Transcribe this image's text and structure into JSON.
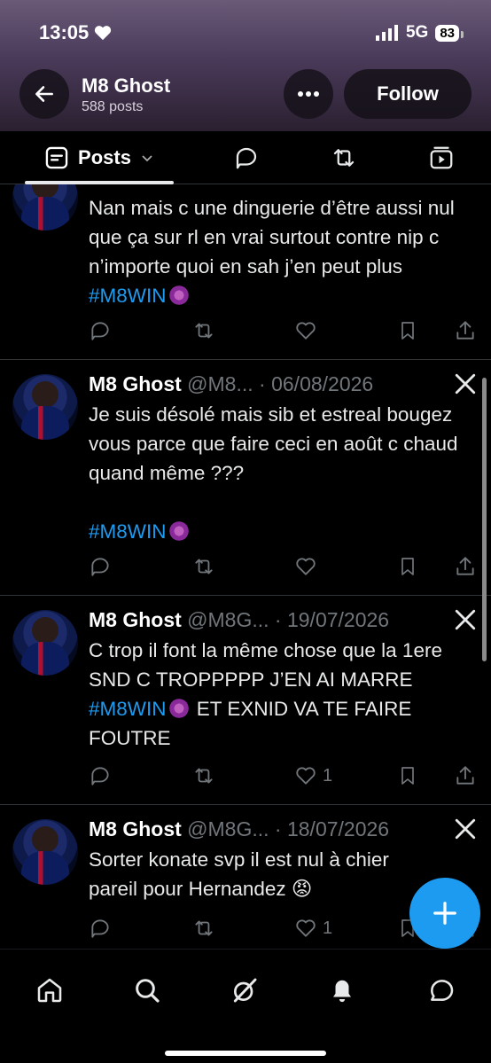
{
  "status_bar": {
    "time": "13:05",
    "network": "5G",
    "battery": "83"
  },
  "header": {
    "name": "M8 Ghost",
    "post_count": "588 posts",
    "follow_label": "Follow"
  },
  "tabs": {
    "posts_label": "Posts"
  },
  "posts": [
    {
      "name": "",
      "handle": "",
      "date": "",
      "text_plain": "Nan mais c une dinguerie d’être aussi nul que ça sur rl en vrai surtout contre nip c n’importe quoi en sah j’en peut plus ",
      "hashtag": "#M8WIN",
      "like_count": ""
    },
    {
      "name": "M8 Ghost",
      "handle": "@M8...",
      "date": "· 06/08/2026",
      "text_plain": "Je suis désolé mais sib et estreal bougez vous parce que faire ceci en août c chaud quand même ???",
      "hashtag": "#M8WIN",
      "like_count": ""
    },
    {
      "name": "M8 Ghost",
      "handle": "@M8G...",
      "date": "· 19/07/2026",
      "text_before": "C trop il font la même chose que la 1ere SND C TROPPPPP J’EN AI MARRE ",
      "hashtag": "#M8WIN",
      "text_after": " ET EXNID VA TE FAIRE FOUTRE",
      "like_count": "1"
    },
    {
      "name": "M8 Ghost",
      "handle": "@M8G...",
      "date": "· 18/07/2026",
      "text_plain": "Sorter konate svp il est nul à chier pareil pour Hernandez 😡",
      "like_count": "1"
    }
  ],
  "colors": {
    "accent": "#1d9bf0",
    "text_secondary": "#71767b",
    "divider": "#2f3336"
  },
  "icons": [
    "back-arrow-icon",
    "more-icon",
    "posts-tab-icon",
    "replies-tab-icon",
    "reposts-tab-icon",
    "media-tab-icon",
    "reply-icon",
    "repost-icon",
    "like-icon",
    "bookmark-icon",
    "share-icon",
    "x-logo-icon",
    "compose-icon",
    "home-icon",
    "search-icon",
    "grok-icon",
    "notifications-icon",
    "messages-icon"
  ]
}
